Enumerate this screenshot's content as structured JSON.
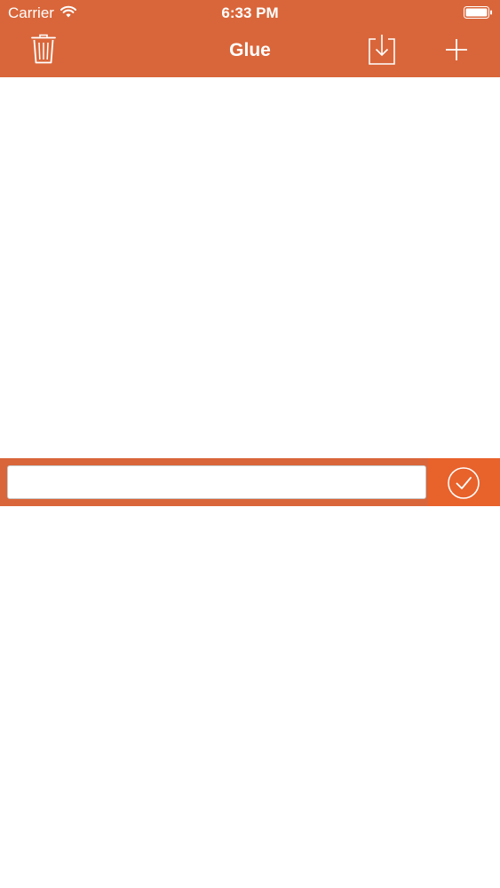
{
  "status_bar": {
    "carrier": "Carrier",
    "time": "6:33 PM",
    "wifi_icon": "wifi-icon",
    "battery_icon": "battery-icon"
  },
  "nav_bar": {
    "title": "Glue",
    "left_icon": "trash-icon",
    "right_icons": [
      "download-icon",
      "plus-icon"
    ]
  },
  "input_bar": {
    "value": "",
    "placeholder": "",
    "submit_icon": "checkmark-circle-icon"
  },
  "colors": {
    "accent": "#d9663a",
    "submit_background": "#e8622c",
    "background": "#ffffff"
  }
}
